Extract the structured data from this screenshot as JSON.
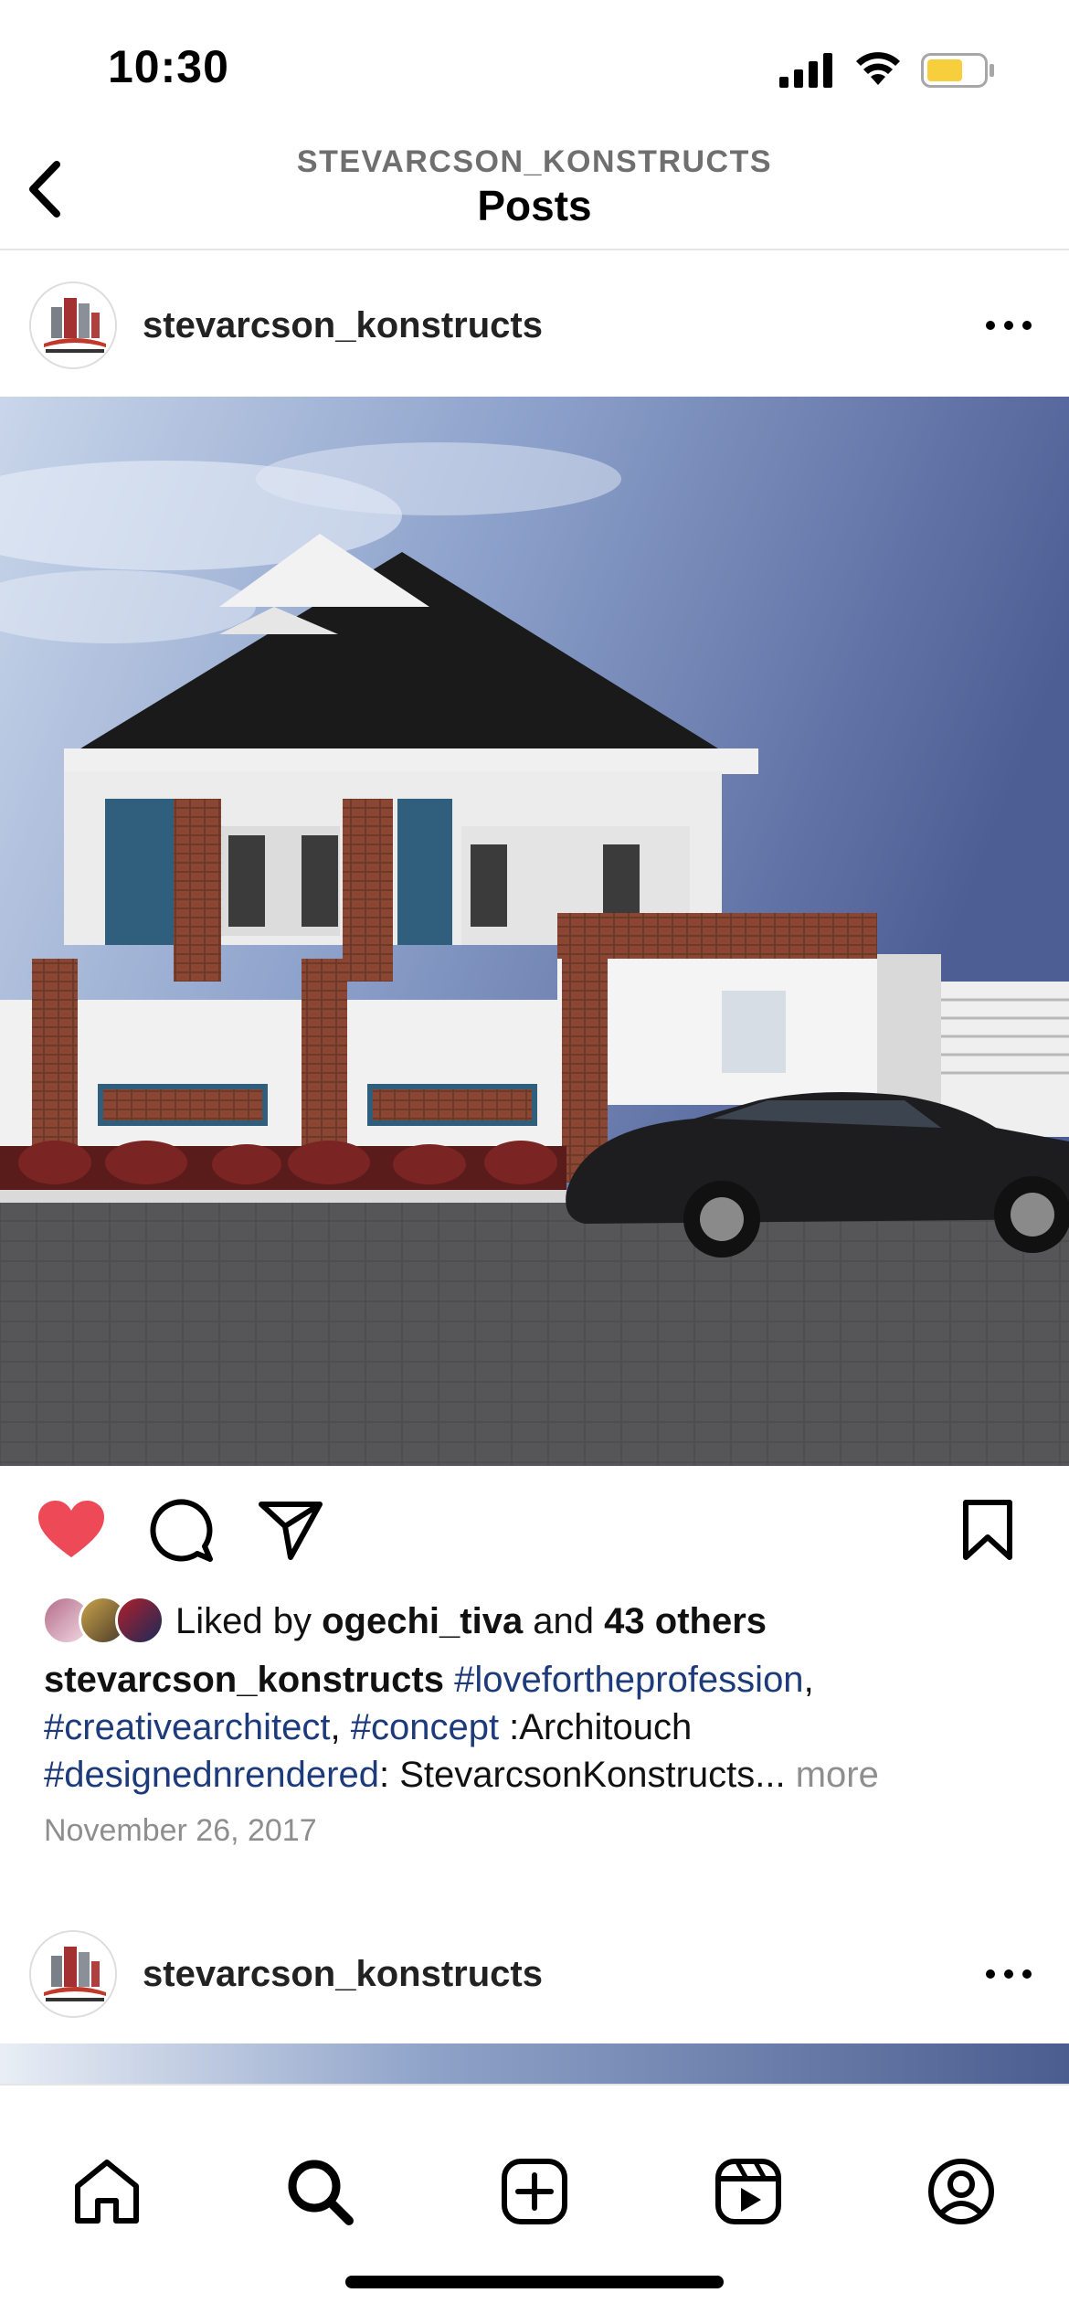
{
  "status_bar": {
    "time": "10:30"
  },
  "header": {
    "username": "STEVARCSON_KONSTRUCTS",
    "title": "Posts"
  },
  "post": {
    "username": "stevarcson_konstructs",
    "liked_by_prefix": "Liked by ",
    "liked_by_user": "ogechi_tiva",
    "liked_by_and": " and ",
    "liked_by_others": "43 others",
    "caption_username": "stevarcson_konstructs",
    "caption_tag_1": "#lovefortheprofession",
    "caption_sep_1": ",",
    "caption_tag_2": "#creativearchitect",
    "caption_sep_2": ", ",
    "caption_tag_3": "#concept",
    "caption_text_1": " :Architouch",
    "caption_tag_4": "#designednrendered",
    "caption_text_2": ": StevarcsonKonstructs... ",
    "more": "more",
    "date": "November 26, 2017",
    "liked": true
  },
  "next_post": {
    "username": "stevarcson_konstructs"
  },
  "colors": {
    "heart": "#ed4956",
    "hashtag": "#1d3a7a",
    "muted": "#8e8e8e",
    "battery": "#f7cf3c"
  },
  "icons": [
    "back-icon",
    "more-icon",
    "heart-icon",
    "comment-icon",
    "share-icon",
    "bookmark-icon",
    "home-icon",
    "search-icon",
    "create-icon",
    "reels-icon",
    "profile-icon"
  ]
}
